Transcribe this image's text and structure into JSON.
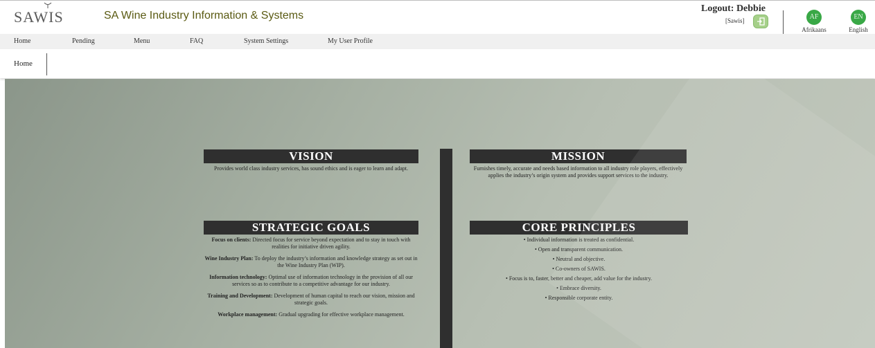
{
  "header": {
    "logo": "SAWIS",
    "app_title": "SA Wine Industry Information & Systems",
    "logout_label": "Logout: Debbie",
    "org": "[Sawis]",
    "languages": [
      {
        "code": "AF",
        "label": "Afrikaans"
      },
      {
        "code": "EN",
        "label": "English"
      }
    ]
  },
  "nav": {
    "items": [
      "Home",
      "Pending",
      "Menu",
      "FAQ",
      "System Settings",
      "My User Profile"
    ]
  },
  "breadcrumb": {
    "current": "Home"
  },
  "content": {
    "vision": {
      "title": "VISION",
      "text": "Provides world class industry services, has sound ethics and is eager to learn and adapt."
    },
    "mission": {
      "title": "MISSION",
      "text": "Furnishes timely, accurate and needs based information to all industry role players, effectively applies the industry’s origin system and provides support services to the industry."
    },
    "strategic_goals": {
      "title": "STRATEGIC GOALS",
      "items": [
        {
          "label": "Focus on clients:",
          "text": " Directed focus for service beyond expectation and to stay in touch with realities for initiative driven agility."
        },
        {
          "label": "Wine Industry Plan:",
          "text": " To deploy the industry’s information and knowledge strategy as set out in the Wine Industry Plan (WIP)."
        },
        {
          "label": "Information technology:",
          "text": " Optimal use of information technology in the provision of all our services so as to contribute to a competitive advantage for our industry."
        },
        {
          "label": "Training and Development:",
          "text": " Development of human capital to reach our vision, mission and strategic goals."
        },
        {
          "label": "Workplace management:",
          "text": " Gradual upgrading for effective workplace management."
        }
      ]
    },
    "core_principles": {
      "title": "CORE PRINCIPLES",
      "items": [
        "• Individual information is treated as confidential.",
        "• Open and transparent communication.",
        "• Neutral and objective.",
        "• Co-owners of SAWIS.",
        "• Focus is to, faster, better and cheaper, add value for the industry.",
        "• Embrace diversity.",
        "• Responsible corporate entity."
      ]
    }
  },
  "colors": {
    "accent_green": "#39a846",
    "header_band": "#2f2f2f",
    "title_olive": "#5a5a12"
  },
  "icons": {
    "logout": "exit-door-icon",
    "logo_glass": "wine-glass-icon"
  }
}
